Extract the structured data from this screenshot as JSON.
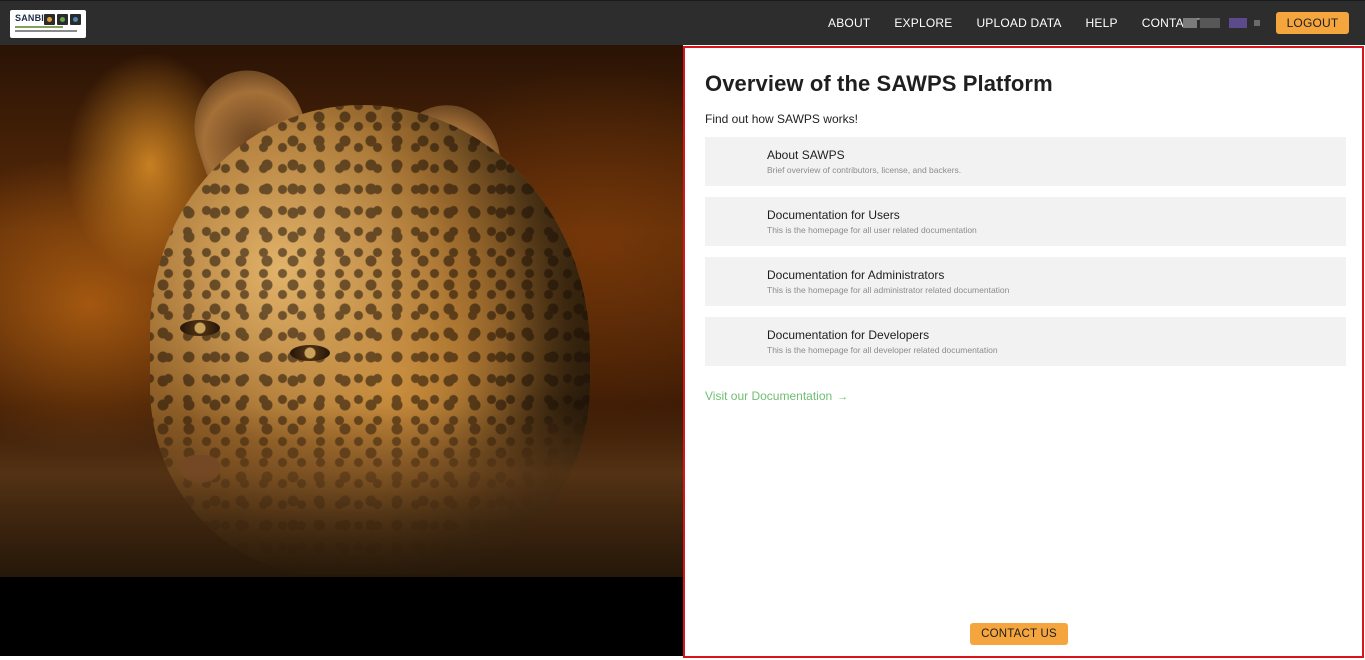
{
  "logo": {
    "text": "SANBI"
  },
  "nav": {
    "links": [
      "ABOUT",
      "EXPLORE",
      "UPLOAD DATA",
      "HELP",
      "CONTACT"
    ],
    "logout_label": "LOGOUT"
  },
  "panel": {
    "title": "Overview of the SAWPS Platform",
    "intro": "Find out how SAWPS works!",
    "cards": [
      {
        "title": "About SAWPS",
        "desc": "Brief overview of contributors, license, and backers."
      },
      {
        "title": "Documentation for Users",
        "desc": "This is the homepage for all user related documentation"
      },
      {
        "title": "Documentation for Administrators",
        "desc": "This is the homepage for all administrator related documentation"
      },
      {
        "title": "Documentation for Developers",
        "desc": "This is the homepage for all developer related documentation"
      }
    ],
    "doc_link": "Visit our Documentation",
    "doc_link_arrow": "→",
    "contact_label": "CONTACT US"
  },
  "colors": {
    "navbar_bg": "#2d2d2d",
    "accent_orange": "#f5a53d",
    "link_green": "#6fbf73",
    "card_bg": "#f2f2f2",
    "highlight_border": "#d9141a"
  },
  "icons": {
    "arrow": "right-arrow-icon"
  }
}
